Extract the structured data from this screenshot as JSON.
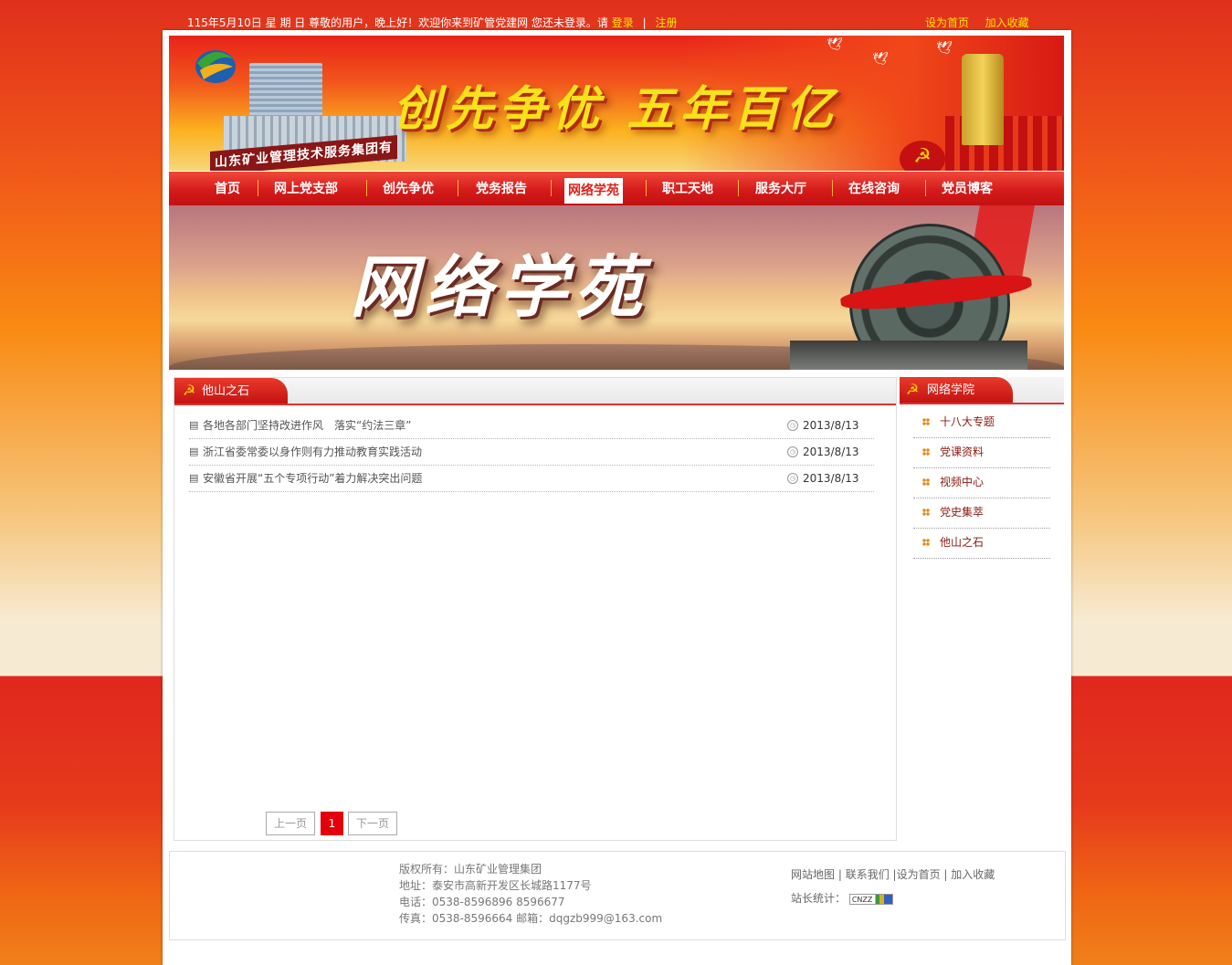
{
  "topbar": {
    "greeting": "115年5月10日 星 期 日 尊敬的用户，晚上好！欢迎你来到矿管党建网 您还未登录。请",
    "login": "登录",
    "separator": "|",
    "register": "注册",
    "set_home": "设为首页",
    "add_favorite": "加入收藏"
  },
  "header": {
    "company_name": "山东矿业管理技术服务集团有限公司",
    "slogan": "创先争优  五年百亿"
  },
  "nav": {
    "items": [
      {
        "label": "首页"
      },
      {
        "label": "网上党支部"
      },
      {
        "label": "创先争优"
      },
      {
        "label": "党务报告"
      },
      {
        "label": "网络学苑"
      },
      {
        "label": "职工天地"
      },
      {
        "label": "服务大厅"
      },
      {
        "label": "在线咨询"
      },
      {
        "label": "党员博客"
      }
    ],
    "active": "网络学苑"
  },
  "subbanner": {
    "title": "网络学苑"
  },
  "main": {
    "section_title": "他山之石",
    "news": [
      {
        "title": "各地各部门坚持改进作风　落实“约法三章”",
        "date": "2013/8/13"
      },
      {
        "title": "浙江省委常委以身作则有力推动教育实践活动",
        "date": "2013/8/13"
      },
      {
        "title": "安徽省开展“五个专项行动”着力解决突出问题",
        "date": "2013/8/13"
      }
    ],
    "pager": {
      "prev": "上一页",
      "current": "1",
      "next": "下一页"
    }
  },
  "sidebar": {
    "title": "网络学院",
    "items": [
      {
        "label": "十八大专题"
      },
      {
        "label": "党课资料"
      },
      {
        "label": "视频中心"
      },
      {
        "label": "党史集萃"
      },
      {
        "label": "他山之石"
      }
    ]
  },
  "footer": {
    "copyright": "版权所有：山东矿业管理集团",
    "address": "地址：泰安市高新开发区长城路1177号",
    "phone": "电话：0538-8596896  8596677",
    "fax": "传真：0538-8596664 邮箱：dqgzb999@163.com",
    "links": {
      "sitemap": "网站地图",
      "contact": "联系我们",
      "set_home": "设为首页",
      "add_favorite": "加入收藏"
    },
    "stat_label": "站长统计：",
    "cnzz_badge": "CNZZ"
  },
  "colors": {
    "brand_red": "#d51a1a",
    "link_yellow": "#ffe400",
    "pager_active": "#e3000b"
  }
}
